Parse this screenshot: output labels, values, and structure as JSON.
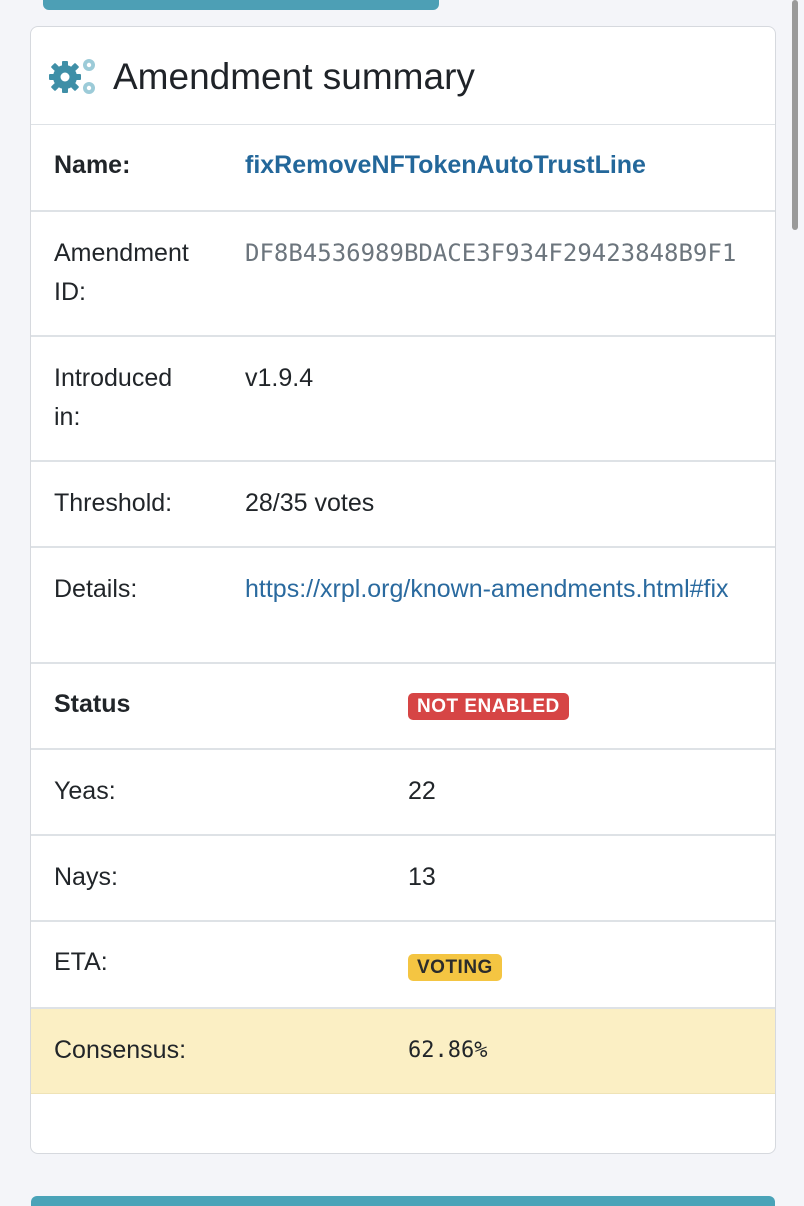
{
  "card": {
    "title": "Amendment summary",
    "icon": "gears-icon"
  },
  "summary": {
    "name_label": "Name:",
    "name_value": "fixRemoveNFTokenAutoTrustLine",
    "id_label_line1": "Amendment",
    "id_label_line2": "ID:",
    "id_value": "DF8B4536989BDACE3F934F29423848B9F1",
    "introduced_label_line1": "Introduced",
    "introduced_label_line2": "in:",
    "introduced_value": "v1.9.4",
    "threshold_label": "Threshold:",
    "threshold_value": "28/35 votes",
    "details_label": "Details:",
    "details_value": "https://xrpl.org/known-amendments.html#fix"
  },
  "status": {
    "header_label": "Status",
    "badge": "NOT ENABLED",
    "yeas_label": "Yeas:",
    "yeas_value": "22",
    "nays_label": "Nays:",
    "nays_value": "13",
    "eta_label": "ETA:",
    "eta_badge": "VOTING",
    "consensus_label": "Consensus:",
    "consensus_value": "62.86%"
  },
  "colors": {
    "accent": "#4d9fb5",
    "link": "#2a6a9f",
    "badge_red": "#d64545",
    "badge_yellow": "#f4c542",
    "highlight": "#fbefc4"
  }
}
